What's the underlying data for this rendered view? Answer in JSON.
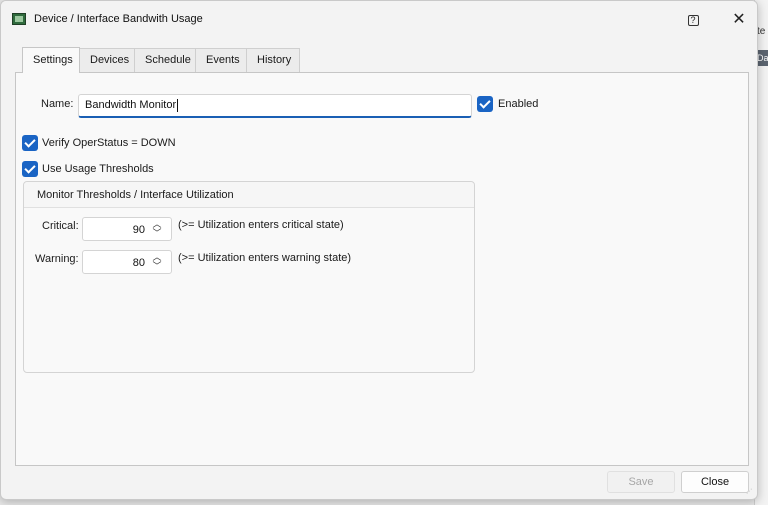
{
  "window": {
    "title": "Device / Interface Bandwith Usage",
    "help_glyph": "?",
    "close_glyph": "✕"
  },
  "background_app": {
    "partial_text": "te",
    "partial_chip": "Da"
  },
  "tabs": [
    {
      "label": "Settings",
      "active": true
    },
    {
      "label": "Devices",
      "active": false
    },
    {
      "label": "Schedule",
      "active": false
    },
    {
      "label": "Events",
      "active": false
    },
    {
      "label": "History",
      "active": false
    }
  ],
  "settings": {
    "name_label": "Name:",
    "name_value": "Bandwidth Monitor",
    "enabled_label": "Enabled",
    "enabled_checked": true,
    "verify_label": "Verify OperStatus = DOWN",
    "verify_checked": true,
    "thresholds_label": "Use Usage Thresholds",
    "thresholds_checked": true
  },
  "thresholds_group": {
    "title": "Monitor Thresholds / Interface Utilization",
    "critical": {
      "label": "Critical:",
      "value": "90",
      "hint": "(>= Utilization enters critical state)"
    },
    "warning": {
      "label": "Warning:",
      "value": "80",
      "hint": "(>= Utilization enters warning state)"
    }
  },
  "footer": {
    "save_label": "Save",
    "save_enabled": false,
    "close_label": "Close"
  },
  "colors": {
    "accent": "#1a64c4",
    "window_bg": "#f3f3f3",
    "panel_bg": "#f9f9f9"
  }
}
